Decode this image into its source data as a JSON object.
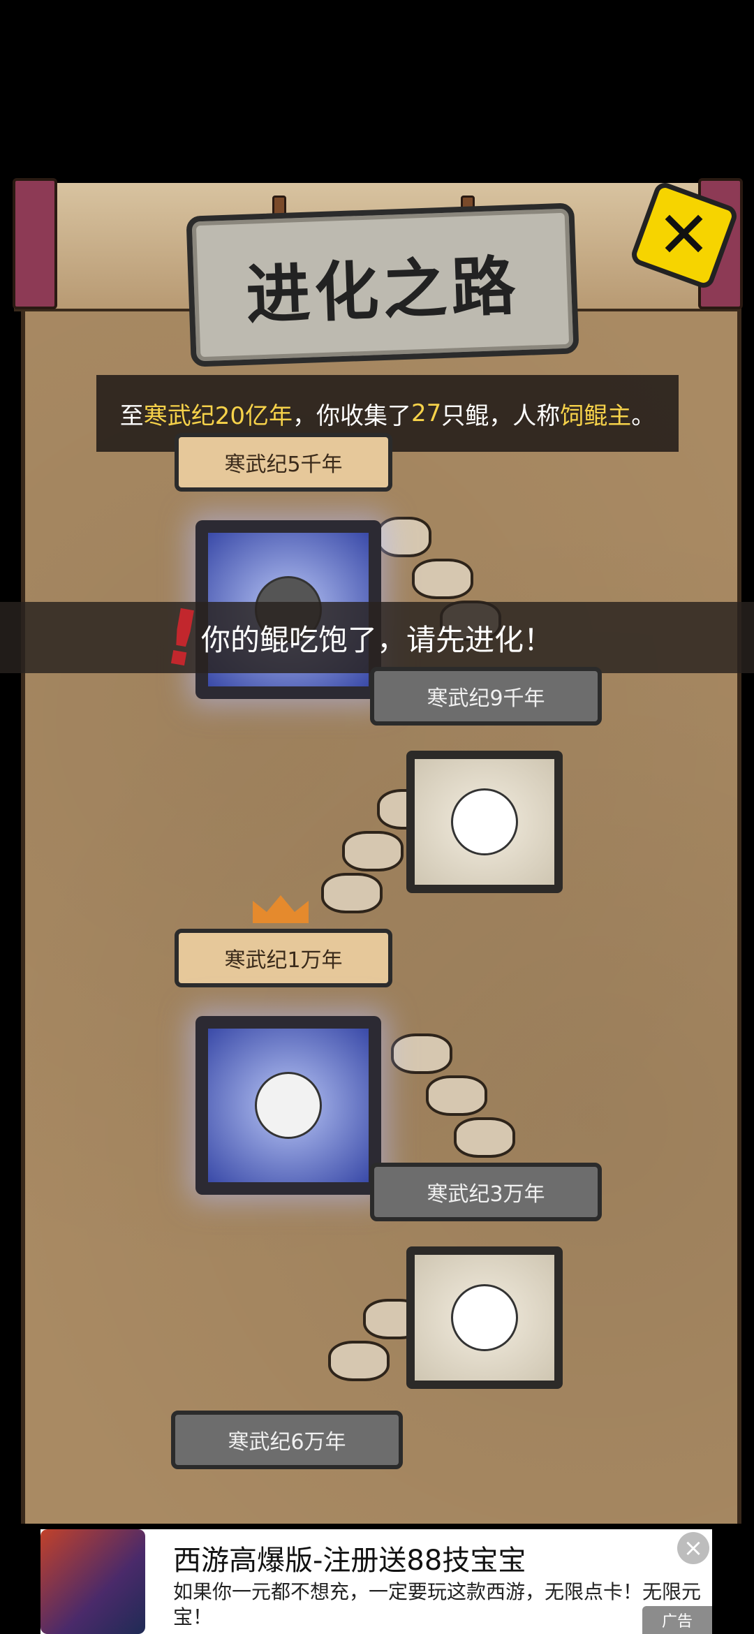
{
  "title": "进化之路",
  "banner": {
    "prefix": "至",
    "era": "寒武纪20亿年",
    "middle": "，你收集了",
    "count": "27",
    "suffix1": "只鲲，人称",
    "nickname": "饲鲲主",
    "suffix2": "。"
  },
  "toast": "你的鲲吃饱了，请先进化！",
  "stages": [
    {
      "label": "寒武纪5千年"
    },
    {
      "label": "寒武纪9千年"
    },
    {
      "label": "寒武纪1万年"
    },
    {
      "label": "寒武纪3万年"
    },
    {
      "label": "寒武纪6万年"
    }
  ],
  "ad": {
    "title": "西游高爆版-注册送88技宝宝",
    "description": "如果你一元都不想充，一定要玩这款西游，无限点卡！无限元宝！",
    "close_symbol": "×",
    "badge": "广告"
  },
  "icons": {
    "close": "close-x-icon",
    "crown": "crown-icon",
    "warning": "exclamation-icon"
  }
}
